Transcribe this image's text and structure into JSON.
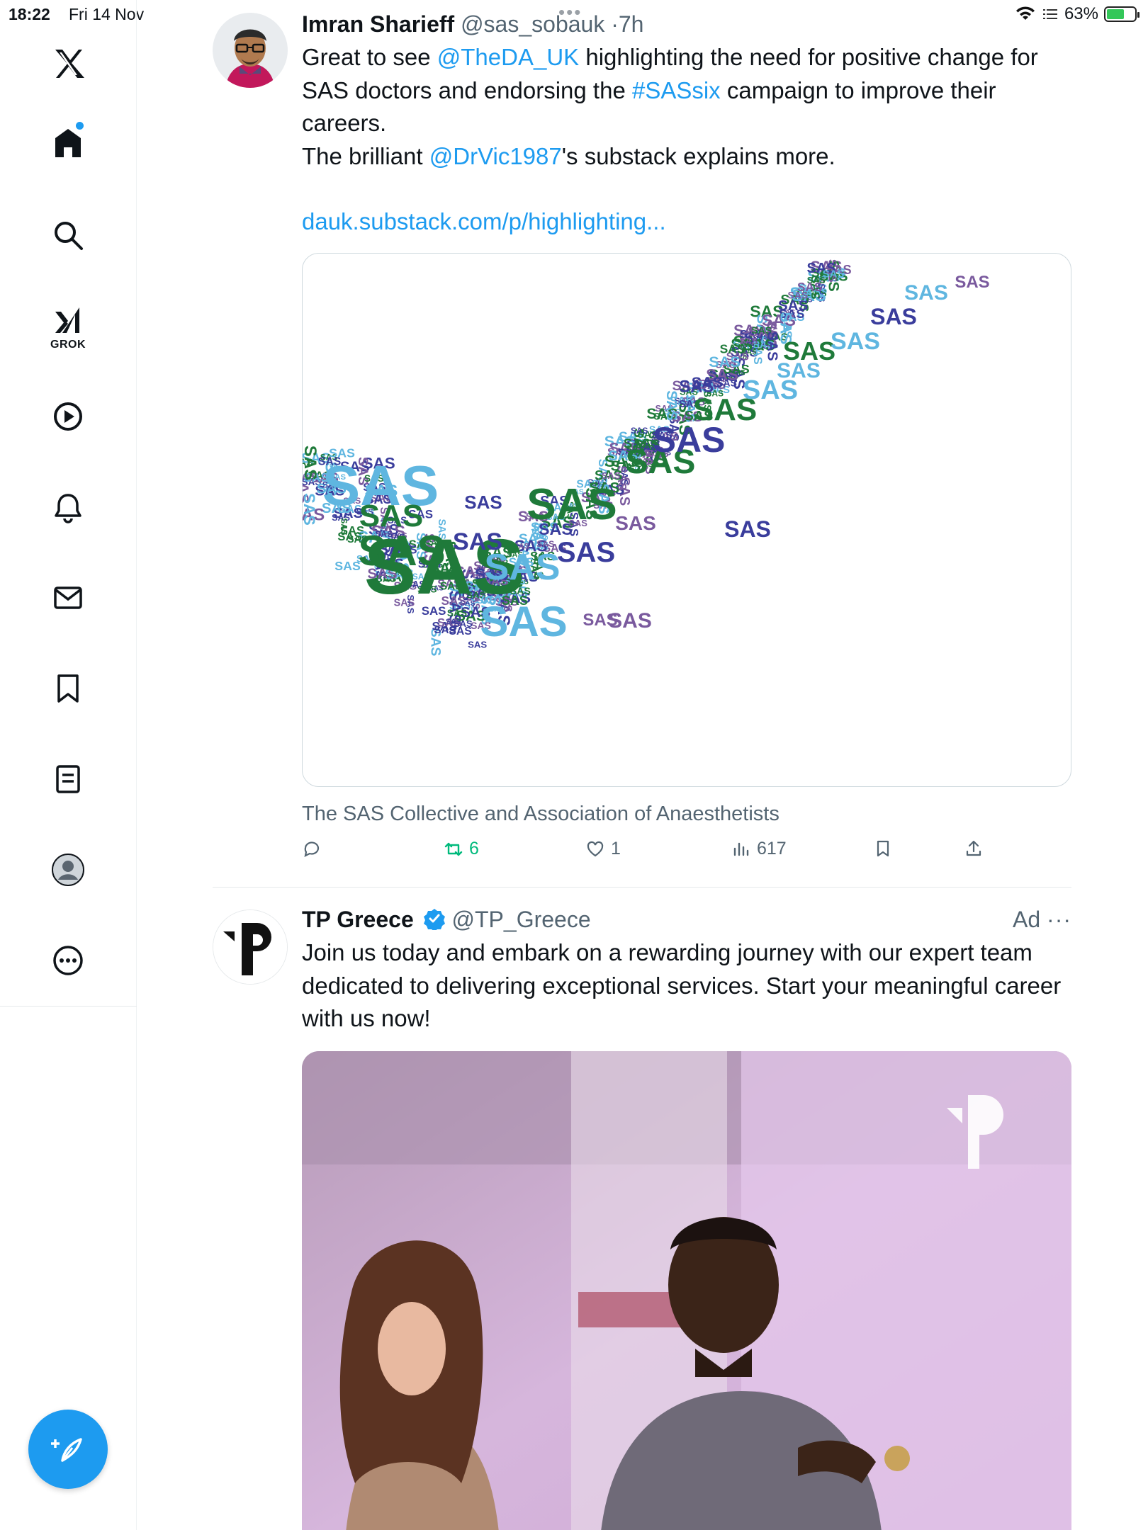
{
  "status_bar": {
    "time": "18:22",
    "date": "Fri 14 Nov",
    "battery_pct": "63%",
    "battery_level": 0.63
  },
  "sidebar": {
    "logo": "x-logo-icon",
    "grok_label": "GROK",
    "items": [
      {
        "name": "home",
        "icon": "home-icon"
      },
      {
        "name": "explore",
        "icon": "search-icon"
      },
      {
        "name": "grok",
        "icon": "grok-icon"
      },
      {
        "name": "video",
        "icon": "play-icon"
      },
      {
        "name": "notifications",
        "icon": "bell-icon"
      },
      {
        "name": "messages",
        "icon": "mail-icon"
      },
      {
        "name": "bookmarks",
        "icon": "bookmark-icon"
      },
      {
        "name": "lists",
        "icon": "list-icon"
      },
      {
        "name": "profile",
        "icon": "avatar-icon"
      },
      {
        "name": "more",
        "icon": "more-icon"
      }
    ],
    "compose_icon": "compose-icon"
  },
  "tweets": [
    {
      "author": "Imran Sharieff",
      "handle": "@sas_sobauk",
      "time": "7h",
      "text_part1": "Great to see ",
      "mention1": "@TheDA_UK",
      "text_part2": " highlighting the need for positive change for SAS doctors and endorsing the ",
      "hashtag": "#SASsix",
      "text_part3": " campaign to improve their careers.",
      "text_part4": "The brilliant ",
      "mention2": "@DrVic1987",
      "text_part5": "'s substack explains more.",
      "link": "dauk.substack.com/p/highlighting...",
      "card_word": "SAS",
      "card_caption": "The SAS Collective and Association of Anaesthetists",
      "stats": {
        "replies": "",
        "retweets": "6",
        "likes": "1",
        "views": "617"
      }
    },
    {
      "author": "TP Greece",
      "handle": "@TP_Greece",
      "ad_label": "Ad",
      "text": "Join us today and embark on a rewarding journey with our expert team dedicated to delivering exceptional services. Start your meaningful career with us now!"
    }
  ],
  "colors": {
    "accent": "#1d9bf0",
    "retweet": "#00ba7c",
    "sas_green": "#1f7a3a",
    "sas_navy": "#3a3d9c",
    "sas_sky": "#5fb6e0",
    "sas_purple": "#7a5a9e"
  }
}
